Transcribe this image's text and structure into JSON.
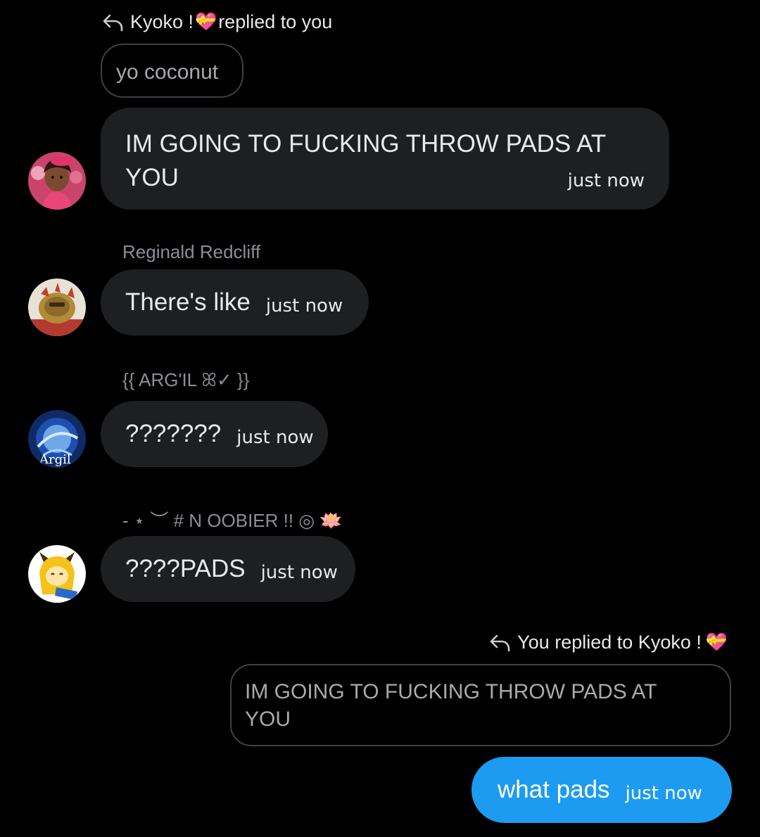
{
  "colors": {
    "background": "#000000",
    "incoming_bubble": "#1e1f21",
    "outgoing_bubble": "#1d9bf0",
    "muted_text": "#8b8f94",
    "quote_border": "#3e4144"
  },
  "thread": {
    "reply_header_1": {
      "icon": "reply-arrow-icon",
      "name": "Kyoko !",
      "emoji": "💝",
      "suffix": "replied to you"
    },
    "quoted_1": "yo coconut",
    "message_1": {
      "text_line1": "IM GOING TO FUCKING THROW PADS AT",
      "text_line2": "YOU",
      "time": "just now",
      "avatar": "avatar-kyoko"
    },
    "message_2": {
      "sender": "Reginald Redcliff",
      "text": "There's like",
      "time": "just now",
      "avatar": "avatar-reginald"
    },
    "message_3": {
      "sender": "{{ ARG'IL ꕤ✓ }}",
      "text": "???????",
      "time": "just now",
      "avatar": "avatar-argil"
    },
    "message_4": {
      "sender": "- ⋆ ︶ # N OOBIER !! ◎ 🪷",
      "text": "????PADS",
      "time": "just now",
      "avatar": "avatar-noobier"
    },
    "reply_header_2": {
      "icon": "reply-arrow-icon",
      "prefix": "You replied to Kyoko !",
      "emoji": "💝"
    },
    "quoted_2": {
      "line1": "IM GOING TO FUCKING THROW PADS AT",
      "line2": "YOU"
    },
    "message_5": {
      "text": "what pads",
      "time": "just now"
    }
  }
}
